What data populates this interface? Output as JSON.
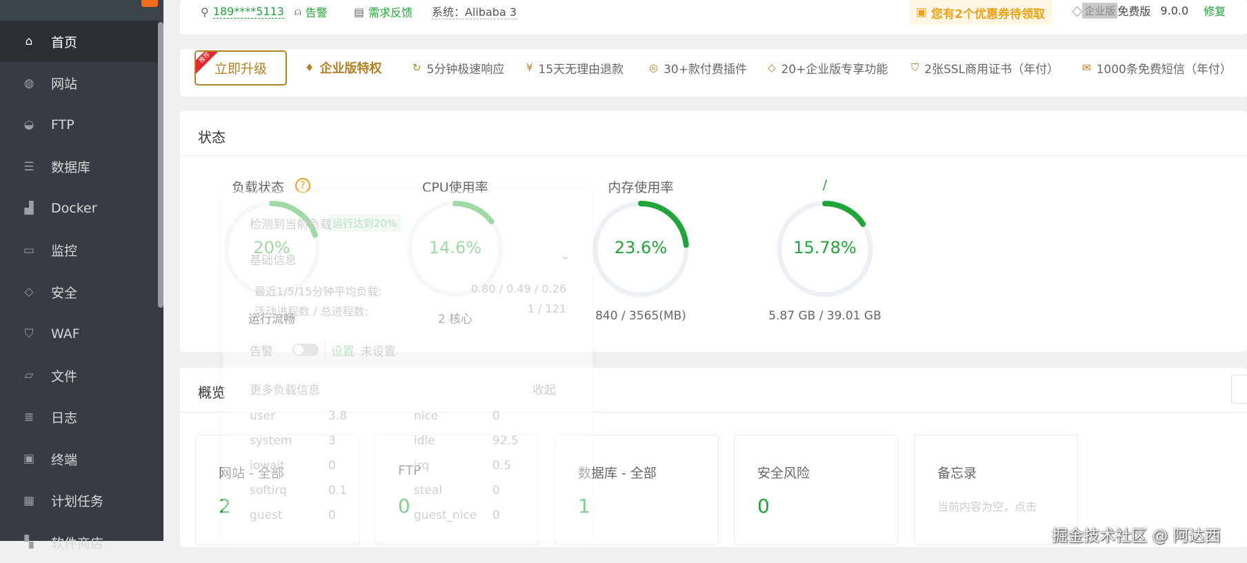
{
  "sidebar": {
    "items": [
      {
        "label": "首页",
        "icon": "home-icon",
        "glyph": "⌂"
      },
      {
        "label": "网站",
        "icon": "globe-icon",
        "glyph": "◍"
      },
      {
        "label": "FTP",
        "icon": "ftp-icon",
        "glyph": "◒"
      },
      {
        "label": "数据库",
        "icon": "database-icon",
        "glyph": "☰"
      },
      {
        "label": "Docker",
        "icon": "docker-icon",
        "glyph": "▟"
      },
      {
        "label": "监控",
        "icon": "monitor-icon",
        "glyph": "▭"
      },
      {
        "label": "安全",
        "icon": "shield-icon",
        "glyph": "◇"
      },
      {
        "label": "WAF",
        "icon": "waf-shield-icon",
        "glyph": "⛉"
      },
      {
        "label": "文件",
        "icon": "folder-icon",
        "glyph": "▱"
      },
      {
        "label": "日志",
        "icon": "log-icon",
        "glyph": "≣"
      },
      {
        "label": "终端",
        "icon": "terminal-icon",
        "glyph": "▣"
      },
      {
        "label": "计划任务",
        "icon": "calendar-icon",
        "glyph": "▦"
      },
      {
        "label": "软件商店",
        "icon": "store-icon",
        "glyph": "▚"
      }
    ]
  },
  "header": {
    "user": "189****5113",
    "alert": "告警",
    "feedback": "需求反馈",
    "system": "系统：Alibaba 3",
    "coupon": "您有2个优惠券待领取",
    "enterprise": "企业版",
    "free": "免费版",
    "version": "9.0.0",
    "repair": "修复"
  },
  "upgrade": {
    "ribbon": "推荐",
    "button": "立即升级",
    "privilege": "企业版特权",
    "features": [
      {
        "label": "5分钟极速响应",
        "glyph": "↻"
      },
      {
        "label": "15天无理由退款",
        "glyph": "¥"
      },
      {
        "label": "30+款付费插件",
        "glyph": "◎"
      },
      {
        "label": "20+企业版专享功能",
        "glyph": "◇"
      },
      {
        "label": "2张SSL商用证书（年付）",
        "glyph": "⛉"
      },
      {
        "label": "1000条免费短信（年付）",
        "glyph": "✉"
      }
    ]
  },
  "status": {
    "title": "状态",
    "gauges": [
      {
        "title": "负载状态",
        "value": "20%",
        "percent": 20,
        "sub": "运行流畅",
        "color": "#52b85e"
      },
      {
        "title": "CPU使用率",
        "value": "14.6%",
        "percent": 14.6,
        "sub": "2 核心",
        "color": "#52b85e"
      },
      {
        "title": "内存使用率",
        "value": "23.6%",
        "percent": 23.6,
        "sub": "840 / 3565(MB)",
        "color": "#20a53a"
      },
      {
        "title": "/",
        "value": "15.78%",
        "percent": 15.78,
        "sub": "5.87 GB / 39.01 GB",
        "color": "#20a53a"
      }
    ]
  },
  "overview": {
    "title": "概览",
    "cards": [
      {
        "title": "网站 - 全部",
        "value": "2"
      },
      {
        "title": "FTP",
        "value": "0"
      },
      {
        "title": "数据库 - 全部",
        "value": "1"
      },
      {
        "title": "安全风险",
        "value": "0"
      },
      {
        "title": "备忘录",
        "empty": "当前内容为空，点击"
      }
    ]
  },
  "load_popup": {
    "detected": "检测到当前负载",
    "tag": "运行达到20%",
    "basic_info": "基础信息",
    "avg_label": "最近1/5/15分钟平均负载:",
    "avg_value": "0.80 / 0.49 / 0.26",
    "proc_label": "活动进程数 / 总进程数:",
    "proc_value": "1 / 121",
    "alert_label": "告警",
    "settings": "设置",
    "not_set": "未设置",
    "more": "更多负载信息",
    "collapse": "收起",
    "cpu_stats": [
      [
        "user",
        "3.8",
        "nice",
        "0"
      ],
      [
        "system",
        "3",
        "idle",
        "92.5"
      ],
      [
        "iowait",
        "0",
        "irq",
        "0.5"
      ],
      [
        "softirq",
        "0.1",
        "steal",
        "0"
      ],
      [
        "guest",
        "0",
        "guest_nice",
        "0"
      ]
    ]
  },
  "watermark": "掘金技术社区 @ 阿达西"
}
